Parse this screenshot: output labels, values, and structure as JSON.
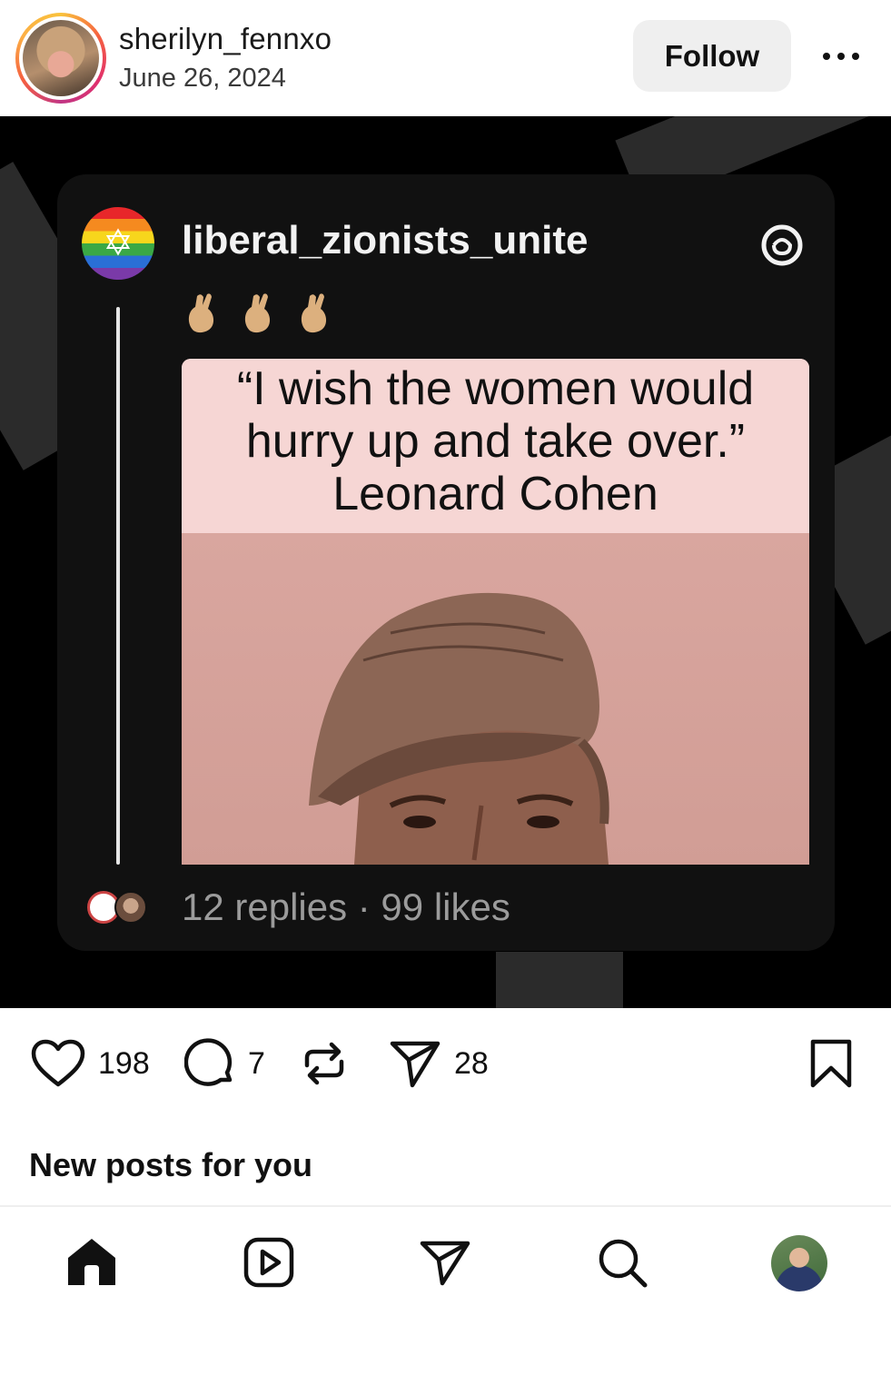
{
  "post": {
    "username": "sherilyn_fennxo",
    "date": "June 26, 2024",
    "follow_label": "Follow"
  },
  "embedded_thread": {
    "username": "liberal_zionists_unite",
    "quote_lines": [
      "“I wish the women would",
      "hurry up and take over.”",
      "Leonard Cohen"
    ],
    "stats": "12 replies · 99 likes"
  },
  "actions": {
    "likes": "198",
    "comments": "7",
    "shares": "28"
  },
  "section": {
    "new_posts": "New posts for you"
  },
  "icons": {
    "more": "more-options-icon",
    "like": "heart-icon",
    "comment": "comment-icon",
    "repost": "repost-icon",
    "share": "send-icon",
    "save": "bookmark-icon",
    "threads": "threads-logo-icon",
    "nav": [
      "home-icon",
      "reels-icon",
      "messages-icon",
      "search-icon",
      "profile-avatar"
    ]
  }
}
